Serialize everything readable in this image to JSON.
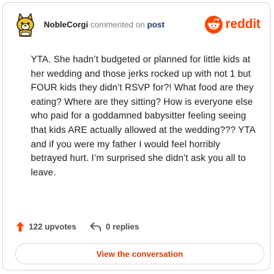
{
  "header": {
    "username": "NobleCorgi",
    "action_text": "commented on",
    "target_text": "post",
    "brand_name": "reddit"
  },
  "comment": {
    "body": "YTA. She hadn’t budgeted or planned for little kids at her wedding and those jerks rocked up with not 1 but FOUR kids they didn’t RSVP for?! What food are they eating? Where are they sitting? How is everyone else who paid for a goddamned babysitter feeling seeing that kids ARE actually allowed at the wedding??? YTA and if you were my father I would feel horribly betrayed hurt. I’m surprised she didn’t ask you all to leave."
  },
  "stats": {
    "upvotes_label": "122 upvotes",
    "replies_label": "0 replies"
  },
  "cta": {
    "label": "View the conversation"
  },
  "colors": {
    "brand": "#ff4500",
    "cta_text": "#d93a00",
    "post_link": "#1c3a6e",
    "border": "#d7dadc"
  },
  "icons": {
    "avatar": "snoo-corgi-avatar",
    "brand": "reddit-snoo-icon",
    "upvote": "upvote-arrow-icon",
    "reply": "reply-arrow-icon"
  }
}
